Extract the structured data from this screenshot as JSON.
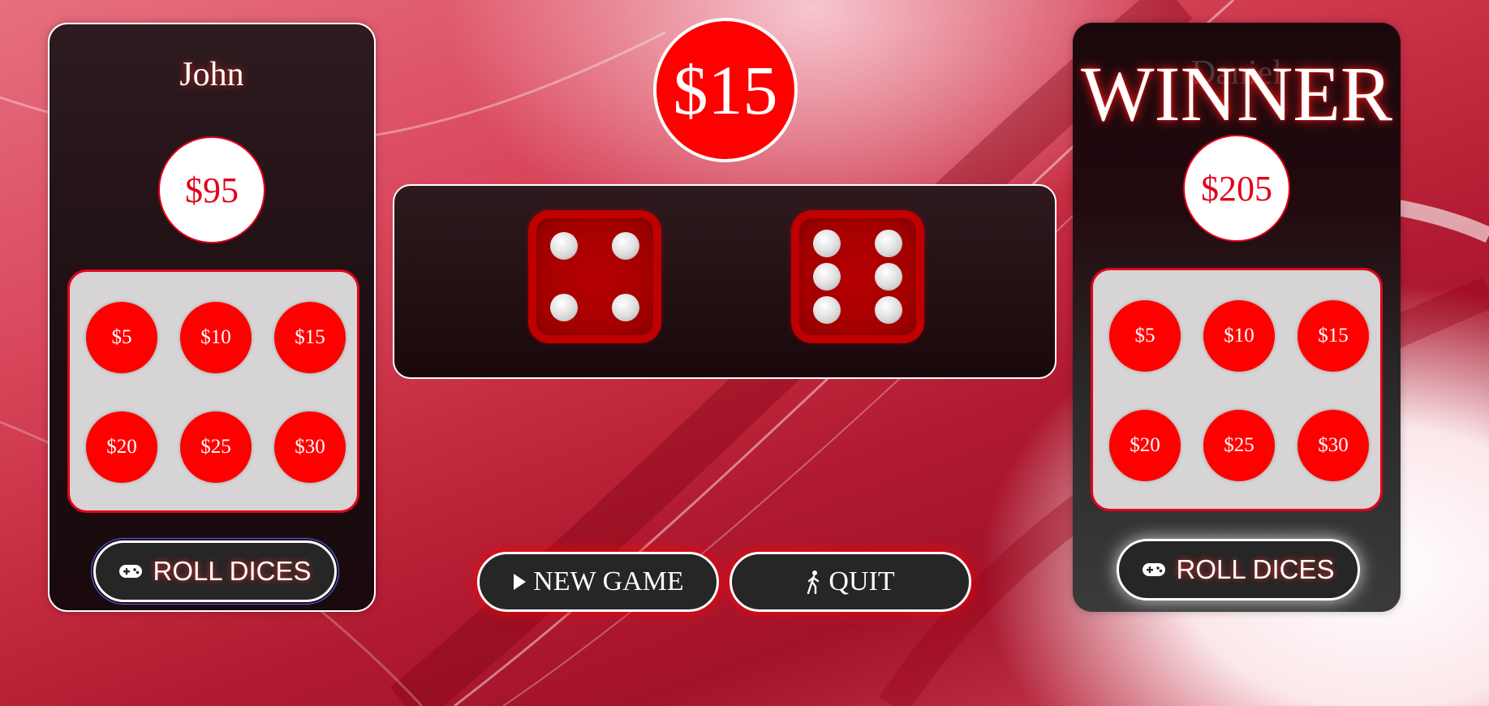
{
  "players": [
    {
      "name": "John",
      "balance": "$95",
      "status_label": "",
      "chips": [
        "$5",
        "$10",
        "$15",
        "$20",
        "$25",
        "$30"
      ],
      "roll_label": "ROLL DICES"
    },
    {
      "name": "Daniel",
      "balance": "$205",
      "status_label": "WINNER",
      "chips": [
        "$5",
        "$10",
        "$15",
        "$20",
        "$25",
        "$30"
      ],
      "roll_label": "ROLL DICES"
    }
  ],
  "pot": "$15",
  "dice": [
    4,
    6
  ],
  "actions": {
    "new_game_label": "NEW GAME",
    "quit_label": "QUIT"
  },
  "icons": {
    "roll": "gamepad-icon",
    "new_game": "play-icon",
    "quit": "walking-person-icon"
  },
  "colors": {
    "accent": "#ff0000",
    "chip": "#ff0000",
    "panel": "#1b0d10",
    "tray": "#d6d4d5"
  }
}
